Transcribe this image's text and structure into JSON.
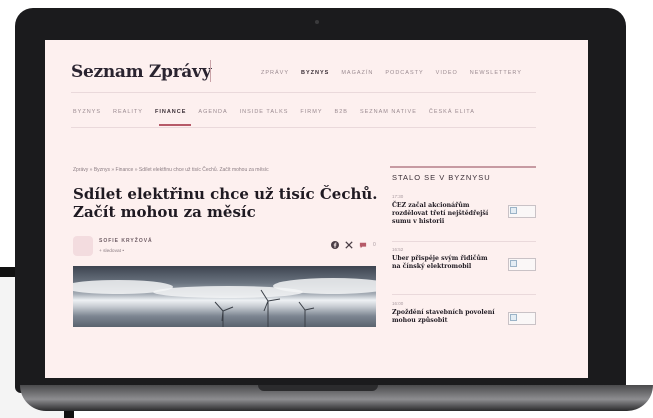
{
  "site": {
    "logo": "Seznam Zprávy"
  },
  "top_nav": [
    "ZPRÁVY",
    "BYZNYS",
    "MAGAZÍN",
    "PODCASTY",
    "VIDEO",
    "NEWSLETTERY"
  ],
  "top_nav_active": "BYZNYS",
  "sub_nav": [
    "BYZNYS",
    "REALITY",
    "FINANCE",
    "AGENDA",
    "INSIDE TALKS",
    "FIRMY",
    "B2B",
    "SEZNAM NATIVE",
    "ČESKÁ ELITA"
  ],
  "sub_nav_active": "FINANCE",
  "breadcrumb": "Zprávy  »  Byznys  »  Finance  »  Sdílet elektřinu chce už tisíc Čechů. Začít mohou za měsíc",
  "article": {
    "title": "Sdílet elektřinu chce už tisíc Čechů. Začít mohou za měsíc",
    "author": "SOFIE KRYŽOVÁ",
    "follow": "+ sledovat",
    "comments": "0"
  },
  "sidebar": {
    "title": "STALO SE V BYZNYSU",
    "items": [
      {
        "time": "17:30",
        "headline": "ČEZ začal akcionářům rozdělovat třetí nejštědřejší sumu v historii"
      },
      {
        "time": "16:52",
        "headline": "Uber přispěje svým řidičům na čínský elektromobil"
      },
      {
        "time": "16:00",
        "headline": "Zpoždění stavebních povolení mohou způsobit"
      }
    ]
  },
  "colors": {
    "page_bg": "#fdf0ef",
    "accent": "#b65a68",
    "text": "#1f1a22"
  },
  "icons": {
    "share": [
      "facebook-icon",
      "x-icon",
      "comment-icon"
    ]
  }
}
